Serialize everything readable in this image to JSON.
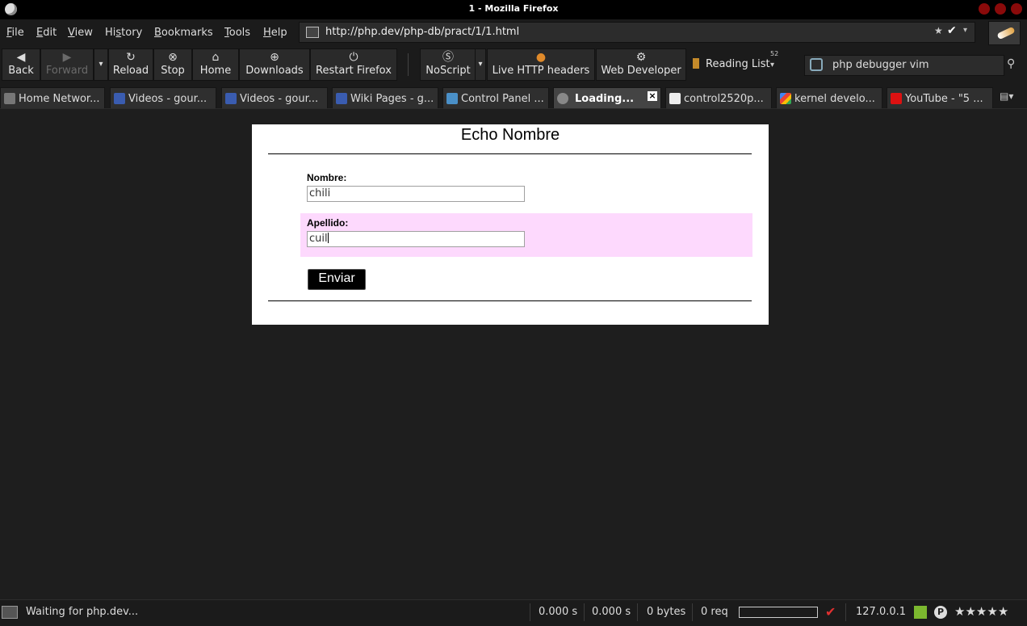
{
  "window": {
    "title": "1 - Mozilla Firefox"
  },
  "menubar": {
    "items": [
      {
        "pre": "",
        "u": "F",
        "post": "ile"
      },
      {
        "pre": "",
        "u": "E",
        "post": "dit"
      },
      {
        "pre": "",
        "u": "V",
        "post": "iew"
      },
      {
        "pre": "Hi",
        "u": "s",
        "post": "tory"
      },
      {
        "pre": "",
        "u": "B",
        "post": "ookmarks"
      },
      {
        "pre": "",
        "u": "T",
        "post": "ools"
      },
      {
        "pre": "",
        "u": "H",
        "post": "elp"
      }
    ],
    "url": "http://php.dev/php-db/pract/1/1.html"
  },
  "toolbar": {
    "back": "Back",
    "forward": "Forward",
    "reload": "Reload",
    "stop": "Stop",
    "home": "Home",
    "downloads": "Downloads",
    "restart": "Restart Firefox",
    "noscript": "NoScript",
    "live_http": "Live HTTP headers",
    "web_dev": "Web Developer",
    "reading_list": "Reading List",
    "reading_count": "52",
    "search_value": "php debugger vim"
  },
  "tabs": [
    {
      "label": "Home Networ...",
      "active": false
    },
    {
      "label": "Videos - gour...",
      "active": false
    },
    {
      "label": "Videos - gour...",
      "active": false
    },
    {
      "label": "Wiki Pages - g...",
      "active": false
    },
    {
      "label": "Control Panel ...",
      "active": false
    },
    {
      "label": "Loading...",
      "active": true
    },
    {
      "label": "control2520p...",
      "active": false
    },
    {
      "label": "kernel develo...",
      "active": false
    },
    {
      "label": "YouTube - \"5 ...",
      "active": false
    }
  ],
  "page": {
    "heading": "Echo Nombre",
    "nombre_label": "Nombre:",
    "nombre_value": "chili",
    "apellido_label": "Apellido:",
    "apellido_value": "cuil",
    "submit": "Enviar"
  },
  "status": {
    "message": "Waiting for php.dev...",
    "time1": "0.000 s",
    "time2": "0.000 s",
    "bytes": "0 bytes",
    "req": "0 req",
    "ip": "127.0.0.1"
  }
}
